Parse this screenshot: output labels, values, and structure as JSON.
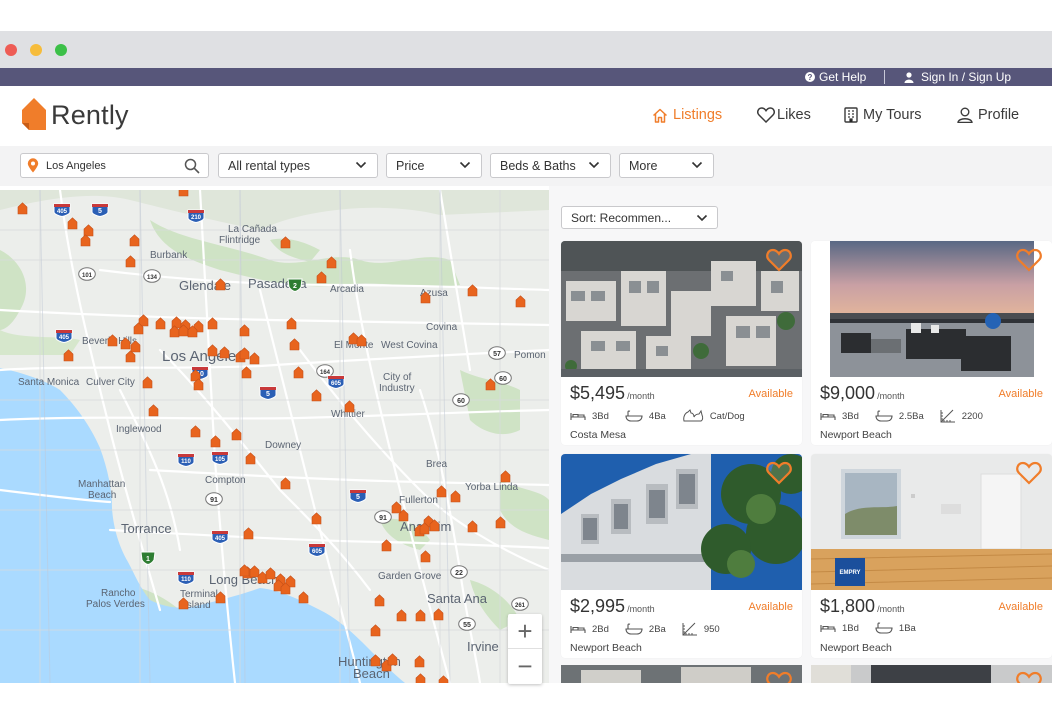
{
  "utility": {
    "help_label": "Get Help",
    "signin_label": "Sign In / Sign Up"
  },
  "brand": {
    "name": "Rently",
    "accent": "#f07d2a",
    "util_bar_color": "#57567a"
  },
  "nav": {
    "listings": "Listings",
    "likes": "Likes",
    "tours": "My Tours",
    "profile": "Profile"
  },
  "filters": {
    "location": "Los Angeles",
    "rental_type": "All rental types",
    "price": "Price",
    "beds_baths": "Beds & Baths",
    "more": "More"
  },
  "sort": {
    "label": "Sort: Recommen..."
  },
  "map_labels": {
    "la_canada": "La Cañada",
    "flintridge": "Flintridge",
    "burbank": "Burbank",
    "glendale": "Glendale",
    "pasadena": "Pasadena",
    "arcadia": "Arcadia",
    "azusa": "Azusa",
    "covina": "Covina",
    "el_monte": "El Monte",
    "west_covina": "West Covina",
    "pomona": "Pomon",
    "beverly_hills": "Beverly Hills",
    "los_angeles": "Los Angeles",
    "santa_monica": "Santa Monica",
    "culver_city": "Culver City",
    "city_of_industry_1": "City of",
    "city_of_industry_2": "Industry",
    "whittier": "Whittier",
    "inglewood": "Inglewood",
    "downey": "Downey",
    "brea": "Brea",
    "manhattan_1": "Manhattan",
    "manhattan_2": "Beach",
    "compton": "Compton",
    "yorba_linda": "Yorba Linda",
    "fullerton": "Fullerton",
    "torrance": "Torrance",
    "anaheim": "Anaheim",
    "garden_grove": "Garden Grove",
    "long_beach": "Long Beach",
    "rancho_1": "Rancho",
    "rancho_2": "Palos Verdes",
    "terminal_1": "Terminal",
    "terminal_2": "Island",
    "santa_ana": "Santa Ana",
    "irvine": "Irvine",
    "huntington_1": "Huntington",
    "huntington_2": "Beach"
  },
  "shields": {
    "s405a": "405",
    "s5a": "5",
    "s210": "210",
    "s101": "101",
    "s134": "134",
    "s2": "2",
    "s405b": "405",
    "s10": "10",
    "s164": "164",
    "s605a": "605",
    "s57": "57",
    "s60a": "60",
    "s60b": "60",
    "s5b": "5",
    "s110a": "110",
    "s105": "105",
    "s91a": "91",
    "s91b": "91",
    "s5c": "5",
    "s405c": "405",
    "s605b": "605",
    "s1": "1",
    "s110b": "110",
    "s22": "22",
    "s261": "261",
    "s55": "55",
    "s5d": "5",
    "s133": "133"
  },
  "listings": [
    {
      "price": "$5,495",
      "per": "/month",
      "status": "Available",
      "beds": "3Bd",
      "baths": "4Ba",
      "extra": "Cat/Dog",
      "extra_icon": "pet-icon",
      "city": "Costa Mesa"
    },
    {
      "price": "$9,000",
      "per": "/month",
      "status": "Available",
      "beds": "3Bd",
      "baths": "2.5Ba",
      "extra": "2200",
      "extra_icon": "area-icon",
      "city": "Newport Beach"
    },
    {
      "price": "$2,995",
      "per": "/month",
      "status": "Available",
      "beds": "2Bd",
      "baths": "2Ba",
      "extra": "950",
      "extra_icon": "area-icon",
      "city": "Newport Beach"
    },
    {
      "price": "$1,800",
      "per": "/month",
      "status": "Available",
      "beds": "1Bd",
      "baths": "1Ba",
      "extra": "",
      "extra_icon": "",
      "city": "Newport Beach",
      "badge": "EMPRY"
    }
  ],
  "zoom": {
    "in": "+",
    "out": "−"
  }
}
